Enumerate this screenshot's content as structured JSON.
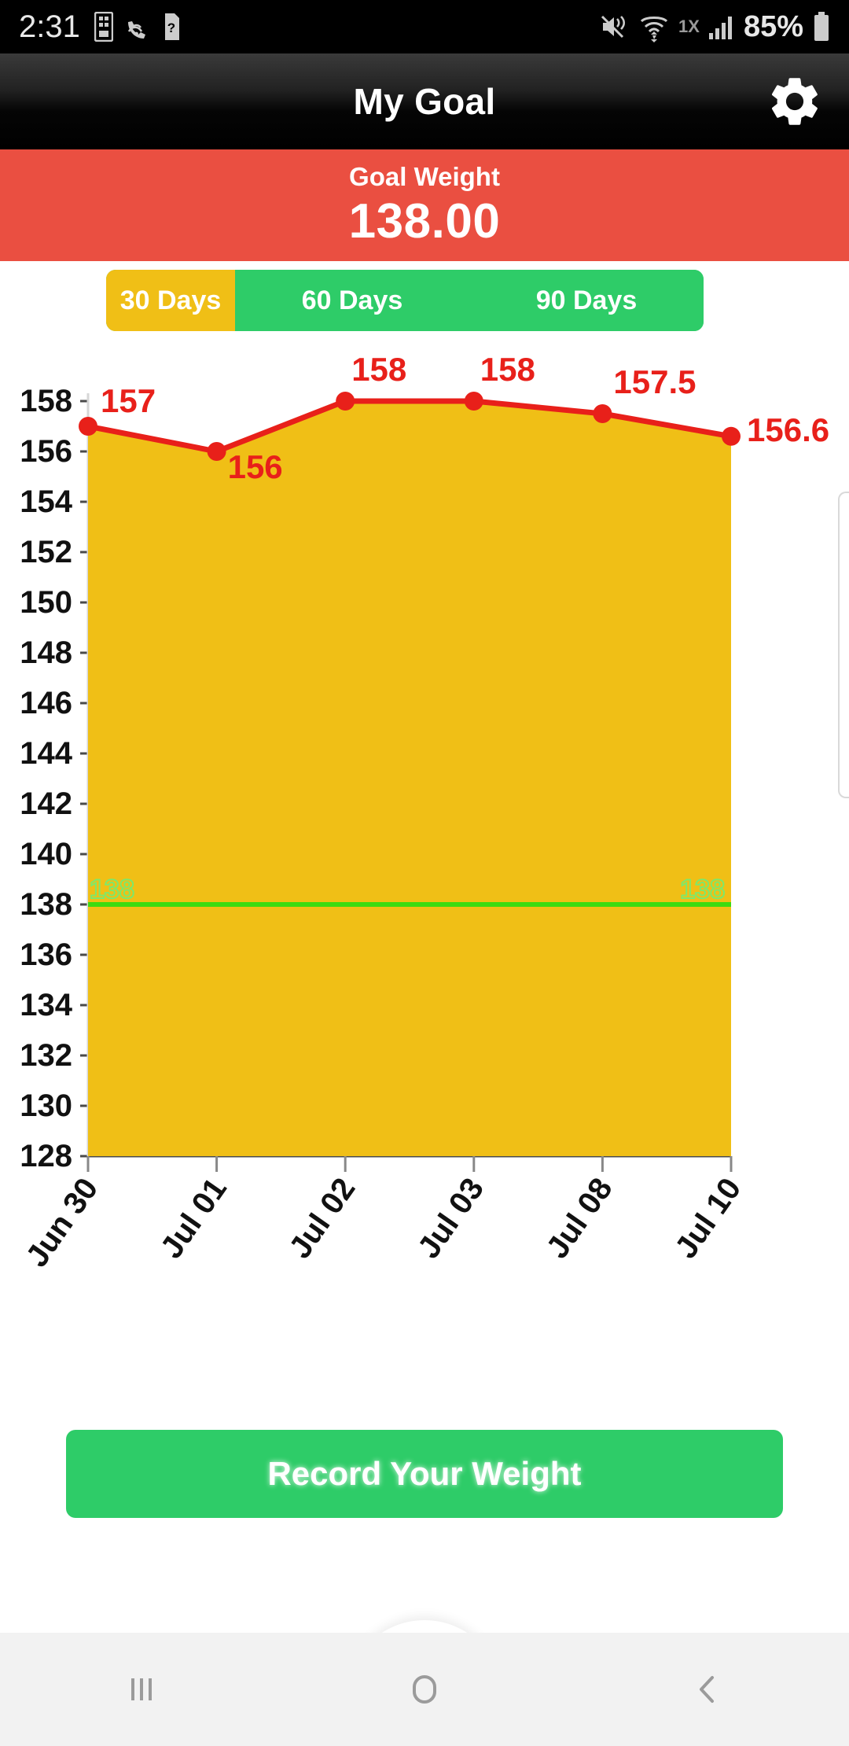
{
  "status_bar": {
    "time": "2:31",
    "battery_percent": "85%",
    "network_label": "1X",
    "icons": [
      "sim-card-icon",
      "wifi-calling-icon",
      "help-sim-icon",
      "mute-vibrate-icon",
      "wifi-icon",
      "signal-bars-icon",
      "battery-icon"
    ]
  },
  "app_bar": {
    "title": "My Goal",
    "settings_icon": "gear-icon"
  },
  "goal_banner": {
    "label": "Goal Weight",
    "value": "138.00",
    "background_color": "#ea4f41"
  },
  "range_tabs": {
    "selected_index": 0,
    "selected_color": "#f0bf16",
    "unselected_color": "#2ecc68",
    "items": [
      {
        "label": "30 Days"
      },
      {
        "label": "60 Days"
      },
      {
        "label": "90 Days"
      }
    ]
  },
  "chart_data": {
    "type": "area",
    "title": "",
    "xlabel": "",
    "ylabel": "",
    "categories": [
      "Jun 30",
      "Jul 01",
      "Jul 02",
      "Jul 03",
      "Jul 08",
      "Jul 10"
    ],
    "values": [
      157,
      156,
      158,
      158,
      157.5,
      156.6
    ],
    "point_labels": [
      "157",
      "156",
      "158",
      "158",
      "157.5",
      "156.6"
    ],
    "ylim": [
      128,
      158
    ],
    "y_ticks": [
      158,
      156,
      154,
      152,
      150,
      148,
      146,
      144,
      142,
      140,
      138,
      136,
      134,
      132,
      130,
      128
    ],
    "grid": false,
    "legend": "none",
    "line_color": "#e8201a",
    "point_color": "#e8201a",
    "fill_color": "#f0bf16",
    "label_color": "#e8201a",
    "goal_line": {
      "value": 138,
      "label": "138",
      "color": "#3ddb10",
      "label_color": "#7ee86a"
    }
  },
  "actions": {
    "record_button": "Record Your Weight",
    "menu_icon": "hamburger-menu-icon"
  },
  "nav_bar": {
    "recents_icon": "recents-icon",
    "home_icon": "home-icon",
    "back_icon": "back-icon"
  }
}
